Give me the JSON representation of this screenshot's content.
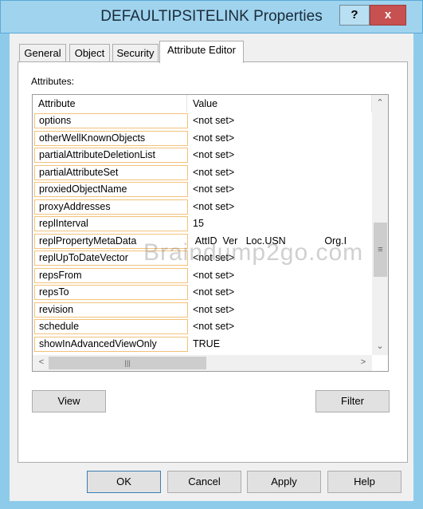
{
  "window": {
    "title": "DEFAULTIPSITELINK Properties",
    "help": "?",
    "close": "x"
  },
  "tabs": [
    {
      "label": "General"
    },
    {
      "label": "Object"
    },
    {
      "label": "Security"
    },
    {
      "label": "Attribute Editor",
      "active": true
    }
  ],
  "attributes_label": "Attributes:",
  "columns": {
    "attribute": "Attribute",
    "value": "Value"
  },
  "rows": [
    {
      "attribute": "options",
      "value": "<not set>"
    },
    {
      "attribute": "otherWellKnownObjects",
      "value": "<not set>"
    },
    {
      "attribute": "partialAttributeDeletionList",
      "value": "<not set>"
    },
    {
      "attribute": "partialAttributeSet",
      "value": "<not set>"
    },
    {
      "attribute": "proxiedObjectName",
      "value": "<not set>"
    },
    {
      "attribute": "proxyAddresses",
      "value": "<not set>"
    },
    {
      "attribute": "replInterval",
      "value": "15"
    },
    {
      "attribute": "replPropertyMetaData",
      "value": " AttID  Ver   Loc.USN              Org.I"
    },
    {
      "attribute": "replUpToDateVector",
      "value": "<not set>"
    },
    {
      "attribute": "repsFrom",
      "value": "<not set>"
    },
    {
      "attribute": "repsTo",
      "value": "<not set>"
    },
    {
      "attribute": "revision",
      "value": "<not set>"
    },
    {
      "attribute": "schedule",
      "value": "<not set>"
    },
    {
      "attribute": "showInAdvancedViewOnly",
      "value": "TRUE"
    }
  ],
  "buttons": {
    "view": "View",
    "filter": "Filter",
    "ok": "OK",
    "cancel": "Cancel",
    "apply": "Apply",
    "help": "Help"
  },
  "watermark": "Braindump2go.com",
  "colors": {
    "titlebar": "#9fd3ee",
    "close": "#c75050",
    "row_border": "#f2c27b"
  }
}
